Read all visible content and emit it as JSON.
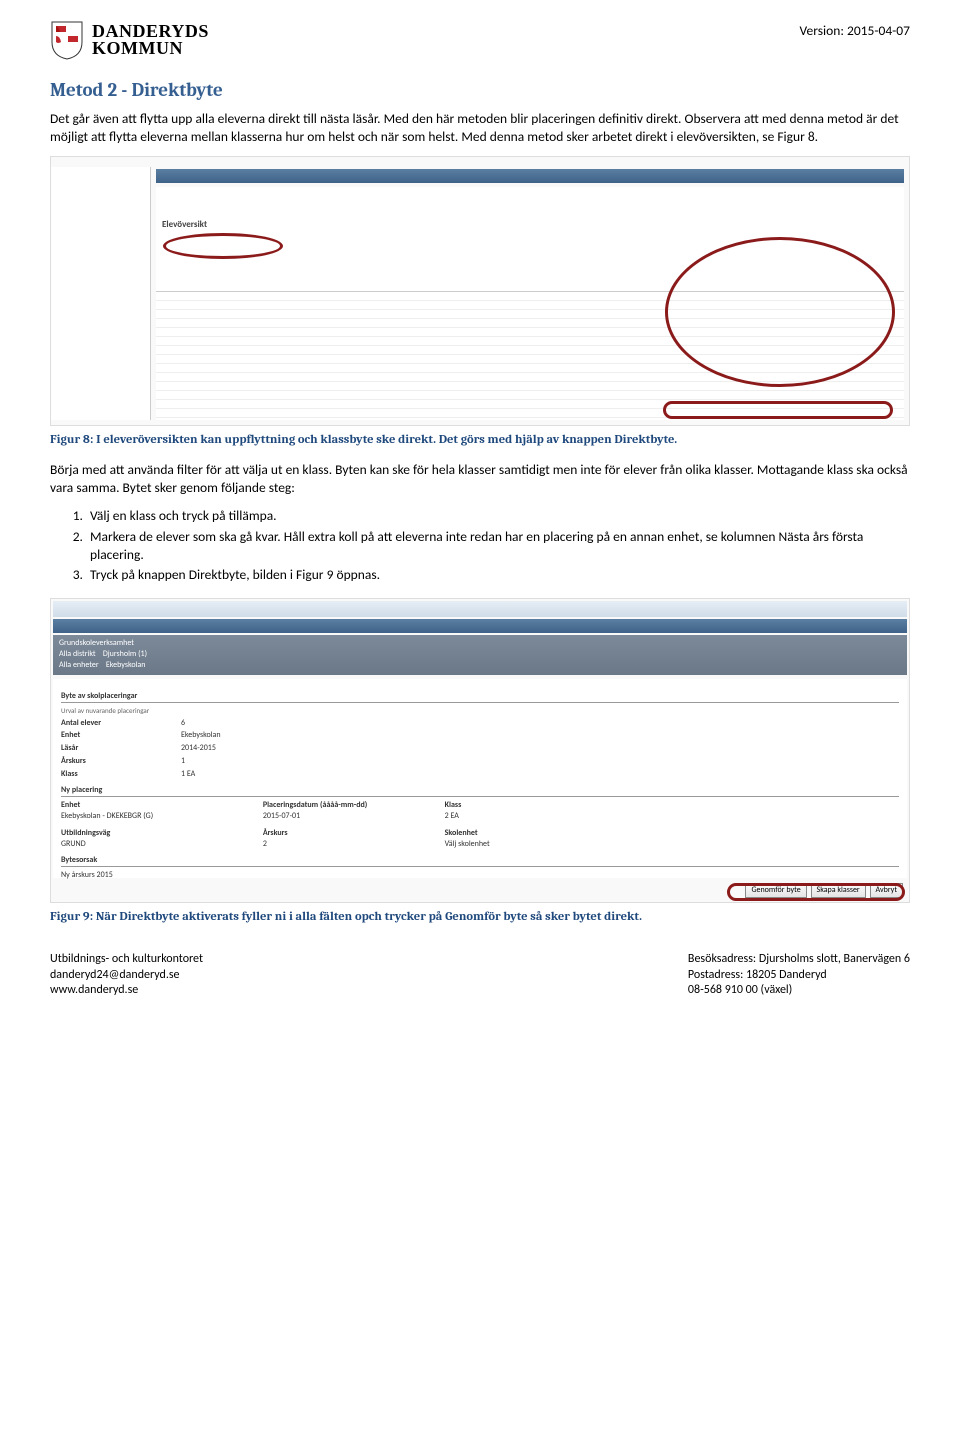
{
  "header": {
    "org_line1": "DANDERYDS",
    "org_line2": "KOMMUN",
    "version": "Version: 2015-04-07"
  },
  "title": "Metod 2 - Direktbyte",
  "intro1": "Det går även att flytta upp alla eleverna direkt till nästa läsår. Med den här metoden blir placeringen definitiv direkt. Observera att med denna metod är det möjligt att flytta eleverna mellan klasserna hur om helst och när som helst. Med denna metod sker arbetet direkt i elevöversikten, se Figur 8.",
  "caption1": "Figur 8: I eleveröversikten kan uppflyttning och klassbyte ske direkt. Det görs med hjälp av knappen Direktbyte.",
  "afterfig1": "Börja med att använda filter för att välja ut en klass. Byten kan ske för hela klasser samtidigt men inte för elever från olika klasser. Mottagande klass ska också vara samma. Bytet sker genom följande steg:",
  "steps": [
    "Välj en klass och tryck på tillämpa.",
    "Markera de elever som ska gå kvar. Håll extra koll på att eleverna inte redan har en placering på en annan enhet, se kolumnen Nästa års första placering.",
    "Tryck på knappen Direktbyte, bilden i Figur 9 öppnas."
  ],
  "caption2": "Figur 9: När Direktbyte aktiverats fyller ni i alla fälten opch trycker på Genomför byte så sker bytet direkt.",
  "fig2_mock": {
    "gray_head": "Grundskoleverksamhet",
    "gray_l1a": "Alla distrikt",
    "gray_l1b": "Djursholm  (1)",
    "gray_l2a": "Alla enheter",
    "gray_l2b": "Ekebyskolan",
    "sec1": "Byte av skolplaceringar",
    "sub1": "Urval av nuvarande placeringar",
    "f_antal_l": "Antal elever",
    "f_antal_v": "6",
    "f_enhet_l": "Enhet",
    "f_enhet_v": "Ekebyskolan",
    "f_lasar_l": "Läsår",
    "f_lasar_v": "2014-2015",
    "f_arskurs_l": "Årskurs",
    "f_arskurs_v": "1",
    "f_klass_l": "Klass",
    "f_klass_v": "1 EA",
    "sec2": "Ny placering",
    "np_enhet_l": "Enhet",
    "np_enhet_v": "Ekebyskolan - DKEKEBGR (G)",
    "np_plac_l": "Placeringsdatum (åååå-mm-dd)",
    "np_plac_v": "2015-07-01",
    "np_klass_l": "Klass",
    "np_klass_v": "2 EA",
    "np_utb_l": "Utbildningsväg",
    "np_utb_v": "GRUND",
    "np_ars_l": "Årskurs",
    "np_ars_v": "2",
    "np_sk_l": "Skolenhet",
    "np_sk_v": "Välj skolenhet",
    "sec3": "Bytesorsak",
    "bytes_v": "Ny årskurs 2015",
    "btn1": "Genomför byte",
    "btn2": "Skapa klasser",
    "btn3": "Avbryt"
  },
  "footer": {
    "left1": "Utbildnings- och kulturkontoret",
    "left2": "danderyd24@danderyd.se",
    "left3": "www.danderyd.se",
    "right1": "Besöksadress: Djursholms slott, Banervägen 6",
    "right2": "Postadress: 18205 Danderyd",
    "right3": "08-568 910 00 (växel)"
  }
}
